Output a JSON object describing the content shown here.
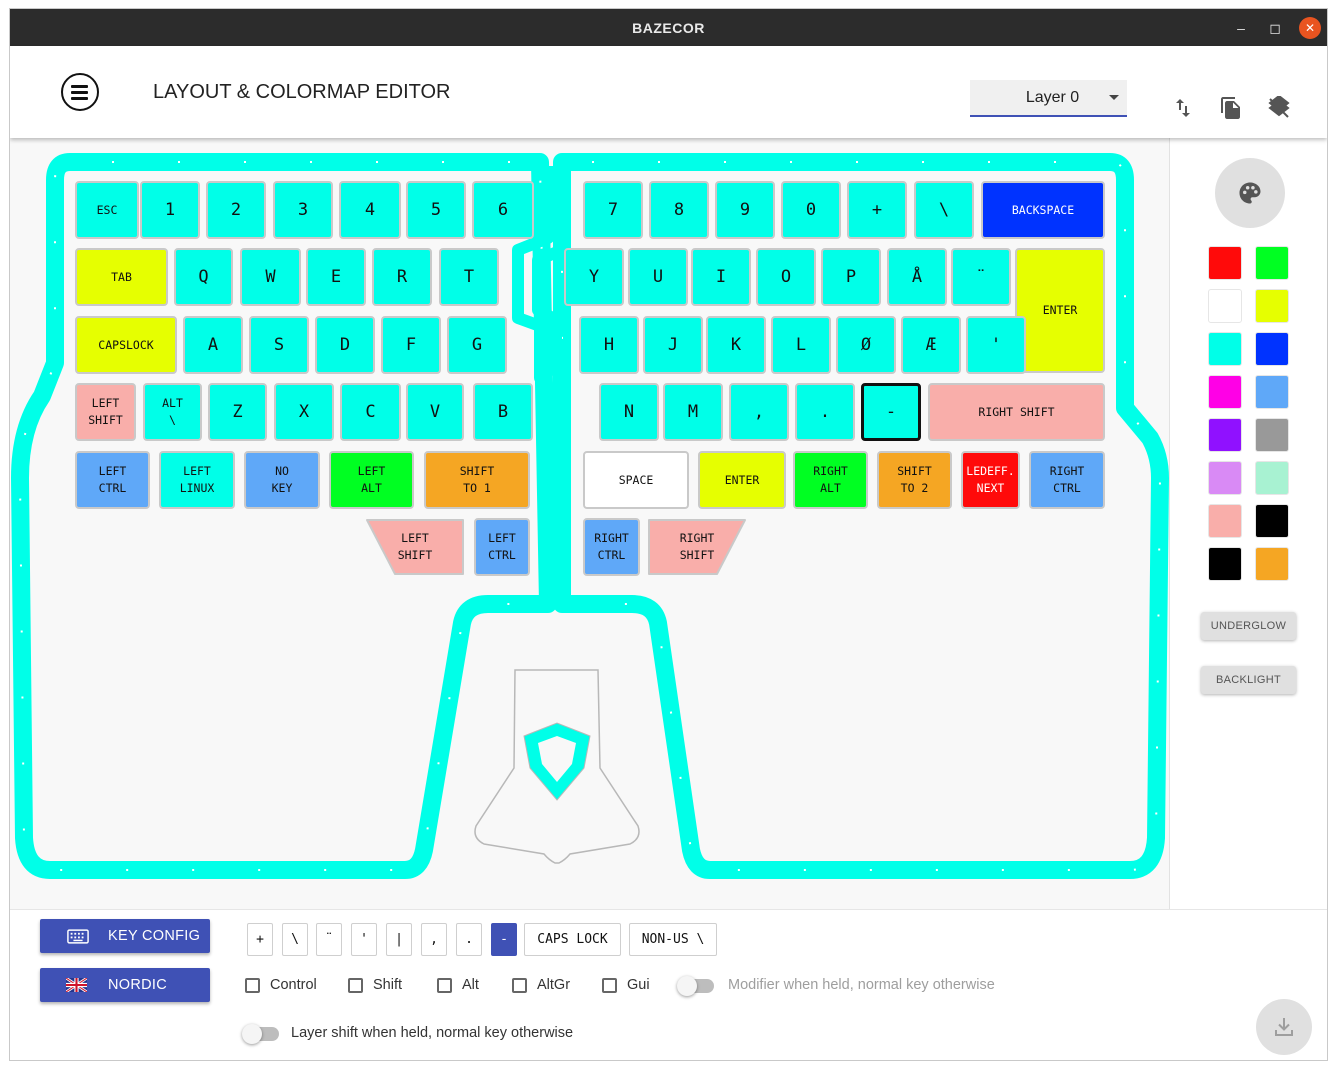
{
  "window": {
    "title": "BAZECOR"
  },
  "header": {
    "title": "LAYOUT & COLORMAP EDITOR",
    "layer": "Layer 0"
  },
  "keys": [
    {
      "label": "ESC",
      "color": "#00ffe8",
      "size": "sm"
    },
    {
      "label": "1",
      "color": "#00ffe8",
      "size": "big"
    },
    {
      "label": "2",
      "color": "#00ffe8",
      "size": "big"
    },
    {
      "label": "3",
      "color": "#00ffe8",
      "size": "big"
    },
    {
      "label": "4",
      "color": "#00ffe8",
      "size": "big"
    },
    {
      "label": "5",
      "color": "#00ffe8",
      "size": "big"
    },
    {
      "label": "6",
      "color": "#00ffe8",
      "size": "big"
    },
    {
      "label": "7",
      "color": "#00ffe8",
      "size": "big"
    },
    {
      "label": "8",
      "color": "#00ffe8",
      "size": "big"
    },
    {
      "label": "9",
      "color": "#00ffe8",
      "size": "big"
    },
    {
      "label": "0",
      "color": "#00ffe8",
      "size": "big"
    },
    {
      "label": "+",
      "color": "#00ffe8",
      "size": "big"
    },
    {
      "label": "\\",
      "color": "#00ffe8",
      "size": "big"
    },
    {
      "label": "BACKSPACE",
      "color": "#0033ff",
      "size": "sm",
      "fg": "#ffffff"
    },
    {
      "label": "TAB",
      "color": "#e6ff00",
      "size": "sm"
    },
    {
      "label": "Q",
      "color": "#00ffe8",
      "size": "big"
    },
    {
      "label": "W",
      "color": "#00ffe8",
      "size": "big"
    },
    {
      "label": "E",
      "color": "#00ffe8",
      "size": "big"
    },
    {
      "label": "R",
      "color": "#00ffe8",
      "size": "big"
    },
    {
      "label": "T",
      "color": "#00ffe8",
      "size": "big"
    },
    {
      "label": "Y",
      "color": "#00ffe8",
      "size": "big"
    },
    {
      "label": "U",
      "color": "#00ffe8",
      "size": "big"
    },
    {
      "label": "I",
      "color": "#00ffe8",
      "size": "big"
    },
    {
      "label": "O",
      "color": "#00ffe8",
      "size": "big"
    },
    {
      "label": "P",
      "color": "#00ffe8",
      "size": "big"
    },
    {
      "label": "Å",
      "color": "#00ffe8",
      "size": "big"
    },
    {
      "label": "¨",
      "color": "#00ffe8",
      "size": "big"
    },
    {
      "label": "ENTER",
      "color": "#e6ff00",
      "size": "sm"
    },
    {
      "label": "CAPSLOCK",
      "color": "#e6ff00",
      "size": "sm"
    },
    {
      "label": "A",
      "color": "#00ffe8",
      "size": "big"
    },
    {
      "label": "S",
      "color": "#00ffe8",
      "size": "big"
    },
    {
      "label": "D",
      "color": "#00ffe8",
      "size": "big"
    },
    {
      "label": "F",
      "color": "#00ffe8",
      "size": "big"
    },
    {
      "label": "G",
      "color": "#00ffe8",
      "size": "big"
    },
    {
      "label": "H",
      "color": "#00ffe8",
      "size": "big"
    },
    {
      "label": "J",
      "color": "#00ffe8",
      "size": "big"
    },
    {
      "label": "K",
      "color": "#00ffe8",
      "size": "big"
    },
    {
      "label": "L",
      "color": "#00ffe8",
      "size": "big"
    },
    {
      "label": "Ø",
      "color": "#00ffe8",
      "size": "big"
    },
    {
      "label": "Æ",
      "color": "#00ffe8",
      "size": "big"
    },
    {
      "label": "'",
      "color": "#00ffe8",
      "size": "big"
    },
    {
      "label": "LEFT\nSHIFT",
      "color": "#f9aeaa",
      "size": "sm"
    },
    {
      "label": "ALT\n\\",
      "color": "#00ffe8",
      "size": "sm"
    },
    {
      "label": "Z",
      "color": "#00ffe8",
      "size": "big"
    },
    {
      "label": "X",
      "color": "#00ffe8",
      "size": "big"
    },
    {
      "label": "C",
      "color": "#00ffe8",
      "size": "big"
    },
    {
      "label": "V",
      "color": "#00ffe8",
      "size": "big"
    },
    {
      "label": "B",
      "color": "#00ffe8",
      "size": "big"
    },
    {
      "label": "N",
      "color": "#00ffe8",
      "size": "big"
    },
    {
      "label": "M",
      "color": "#00ffe8",
      "size": "big"
    },
    {
      "label": ",",
      "color": "#00ffe8",
      "size": "big"
    },
    {
      "label": ".",
      "color": "#00ffe8",
      "size": "big"
    },
    {
      "label": "-",
      "color": "#00ffe8",
      "size": "big",
      "selected": true
    },
    {
      "label": "RIGHT SHIFT",
      "color": "#f9aeaa",
      "size": "sm"
    },
    {
      "label": "LEFT\nCTRL",
      "color": "#5fa8f8",
      "size": "sm"
    },
    {
      "label": "LEFT\nLINUX",
      "color": "#00ffe8",
      "size": "sm"
    },
    {
      "label": "NO\nKEY",
      "color": "#5fa8f8",
      "size": "sm"
    },
    {
      "label": "LEFT\nALT",
      "color": "#00ff22",
      "size": "sm"
    },
    {
      "label": "SHIFT\nTO 1",
      "color": "#f5a623",
      "size": "sm"
    },
    {
      "label": "SPACE",
      "color": "#ffffff",
      "size": "sm"
    },
    {
      "label": "ENTER",
      "color": "#e6ff00",
      "size": "sm"
    },
    {
      "label": "RIGHT\nALT",
      "color": "#00ff22",
      "size": "sm"
    },
    {
      "label": "SHIFT\nTO 2",
      "color": "#f5a623",
      "size": "sm"
    },
    {
      "label": "LEDEFF.\nNEXT",
      "color": "#ff0a0a",
      "size": "sm",
      "fg": "#ffffff"
    },
    {
      "label": "RIGHT\nCTRL",
      "color": "#5fa8f8",
      "size": "sm"
    },
    {
      "label": "LEFT\nSHIFT",
      "color": "#f9aeaa",
      "size": "sm"
    },
    {
      "label": "LEFT\nCTRL",
      "color": "#5fa8f8",
      "size": "sm"
    },
    {
      "label": "RIGHT\nCTRL",
      "color": "#5fa8f8",
      "size": "sm"
    },
    {
      "label": "RIGHT\nSHIFT",
      "color": "#f9aeaa",
      "size": "sm"
    }
  ],
  "palette": [
    "#ff0a0a",
    "#00ff22",
    "#ffffff",
    "#e6ff00",
    "#00ffe8",
    "#0033ff",
    "#ff00e6",
    "#5fa8f8",
    "#9011ff",
    "#999999",
    "#d98af5",
    "#a8f2d2",
    "#f9aeaa",
    "#000000",
    "#000000",
    "#f5a623"
  ],
  "sidebar": {
    "underglow": "UNDERGLOW",
    "backlight": "BACKLIGHT"
  },
  "bottom": {
    "key_config": "KEY CONFIG",
    "nordic": "NORDIC",
    "symbol_keys": [
      "+",
      "\\",
      "¨",
      "'",
      "|",
      ",",
      ".",
      "-",
      "CAPS LOCK",
      "NON-US \\"
    ],
    "selected_symbol": "-",
    "modifiers": [
      "Control",
      "Shift",
      "Alt",
      "AltGr",
      "Gui"
    ],
    "modifier_toggle": "Modifier when held, normal key otherwise",
    "layer_toggle": "Layer shift when held, normal key otherwise"
  }
}
